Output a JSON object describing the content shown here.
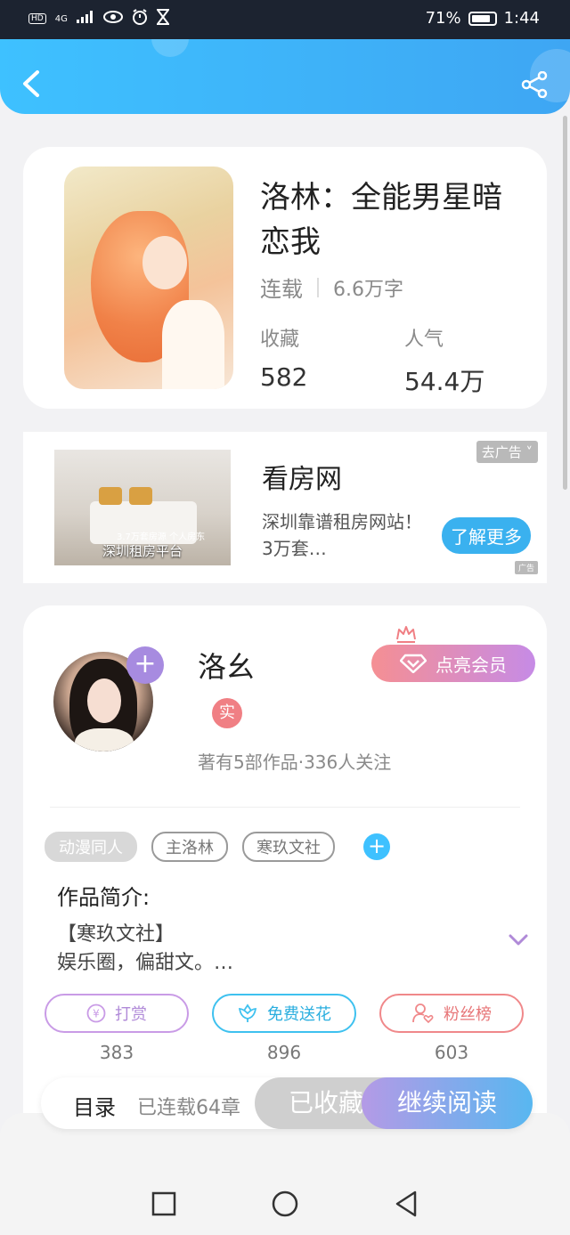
{
  "status_bar": {
    "network": "4G",
    "battery": "71%",
    "time": "1:44"
  },
  "header": {
    "back_icon": "chevron-left-icon",
    "share_icon": "share-icon"
  },
  "book": {
    "title": "洛林：全能男星暗恋我",
    "status": "连载",
    "words": "6.6万字",
    "favorites_label": "收藏",
    "favorites_value": "582",
    "popularity_label": "人气",
    "popularity_value": "54.4万"
  },
  "ad": {
    "title": "看房网",
    "description": "深圳靠谱租房网站！3万套…",
    "close_label": "去广告",
    "cta_label": "了解更多",
    "image_caption": "深圳租房平台",
    "image_caption_small": "3.7万套房源 个人房东",
    "tag": "广告"
  },
  "author": {
    "name": "洛幺",
    "verified_label": "实",
    "stats": "著有5部作品·336人关注",
    "vip_label": "点亮会员"
  },
  "tags": [
    "动漫同人",
    "主洛林",
    "寒玖文社"
  ],
  "intro": {
    "title": "作品简介:",
    "body_line1": "【寒玖文社】",
    "body_line2": "娱乐圈，偏甜文。…"
  },
  "actions": [
    {
      "label": "打赏",
      "count": "383",
      "icon": "yen-icon"
    },
    {
      "label": "免费送花",
      "count": "896",
      "icon": "flower-icon"
    },
    {
      "label": "粉丝榜",
      "count": "603",
      "icon": "fan-heart-icon"
    }
  ],
  "read_bar": {
    "toc_label": "目录",
    "chapters": "已连载64章",
    "favorited_label": "已收藏",
    "continue_label": "继续阅读"
  },
  "colors": {
    "header_accent": "#3ec1ff",
    "continue_gradient_start": "#b49ae6",
    "continue_gradient_end": "#58b7f0",
    "vip_gradient_start": "#f58f93",
    "vip_gradient_end": "#c68be6"
  }
}
